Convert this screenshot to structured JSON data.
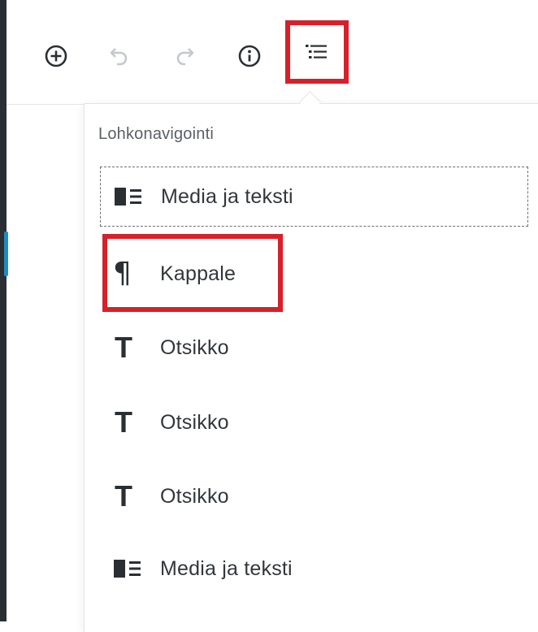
{
  "toolbar": {
    "buttons": [
      {
        "name": "add-block",
        "icon": "plus-circle-icon"
      },
      {
        "name": "undo",
        "icon": "undo-icon"
      },
      {
        "name": "redo",
        "icon": "redo-icon"
      },
      {
        "name": "info",
        "icon": "info-icon"
      },
      {
        "name": "block-navigation",
        "icon": "list-view-icon"
      }
    ]
  },
  "block_navigation": {
    "title": "Lohkonavigointi",
    "items": [
      {
        "label": "Media ja teksti",
        "icon": "media-text-icon",
        "selected": true
      },
      {
        "label": "Kappale",
        "icon": "paragraph-icon",
        "highlighted": true
      },
      {
        "label": "Otsikko",
        "icon": "heading-icon"
      },
      {
        "label": "Otsikko",
        "icon": "heading-icon"
      },
      {
        "label": "Otsikko",
        "icon": "heading-icon"
      },
      {
        "label": "Media ja teksti",
        "icon": "media-text-icon"
      }
    ]
  },
  "colors": {
    "highlight": "#d7202a",
    "text": "#33373b",
    "muted": "#5a5f66",
    "editor_edge": "#2a2f33"
  }
}
